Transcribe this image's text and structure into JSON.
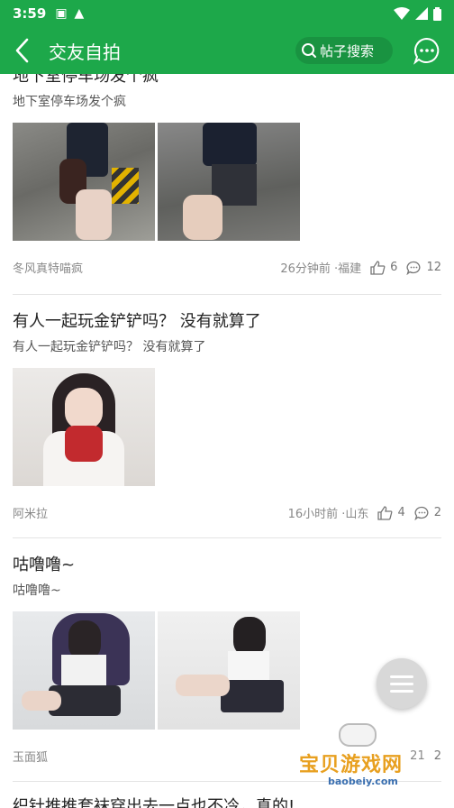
{
  "status_bar": {
    "time": "3:59"
  },
  "app_bar": {
    "title": "交友自拍",
    "search_label": "帖子搜索"
  },
  "posts": [
    {
      "title": "地下室停车场发个疯",
      "subtitle": "地下室停车场发个疯",
      "author": "冬风真特喵疯",
      "time_location": "26分钟前 ·福建",
      "likes": "6",
      "comments": "12"
    },
    {
      "title": "有人一起玩金铲铲吗？ 没有就算了",
      "subtitle": "有人一起玩金铲铲吗？ 没有就算了",
      "author": "阿米拉",
      "time_location": "16小时前 ·山东",
      "likes": "4",
      "comments": "2"
    },
    {
      "title": "咕噜噜~",
      "subtitle": "咕噜噜~",
      "author": "玉面狐",
      "time_location": "21",
      "likes": "",
      "comments": "2"
    },
    {
      "title": "织针推推套袜穿出去一点也不冷，真的!"
    }
  ],
  "watermark": {
    "text": "宝贝游戏网",
    "url": "baobeiy.com"
  },
  "colors": {
    "brand": "#1da84a"
  }
}
